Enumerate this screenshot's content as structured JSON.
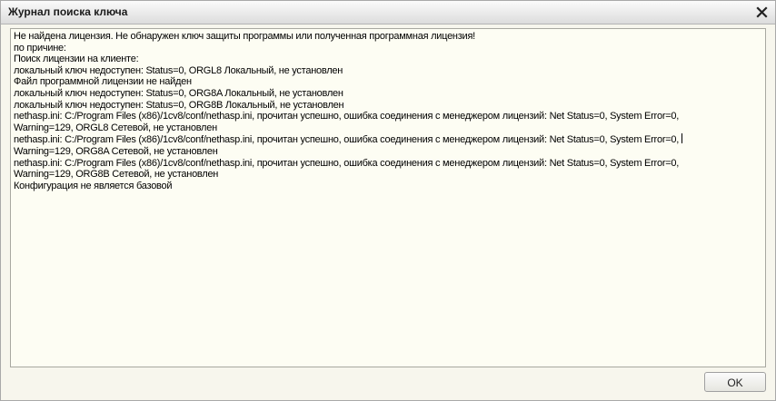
{
  "window": {
    "title": "Журнал поиска ключа"
  },
  "log": {
    "lines": [
      "Не найдена лицензия. Не обнаружен ключ защиты программы или полученная программная лицензия!",
      "по причине:",
      "Поиск лицензии на клиенте:",
      "локальный ключ недоступен: Status=0, ORGL8 Локальный, не установлен",
      "Файл программной лицензии не найден",
      "локальный ключ недоступен: Status=0, ORG8A Локальный, не установлен",
      "локальный ключ недоступен: Status=0, ORG8B Локальный, не установлен",
      "nethasp.ini: C:/Program Files (x86)/1cv8/conf/nethasp.ini, прочитан успешно, ошибка соединения с менеджером лицензий: Net Status=0, System Error=0,",
      "Warning=129, ORGL8 Сетевой, не установлен",
      "nethasp.ini: C:/Program Files (x86)/1cv8/conf/nethasp.ini, прочитан успешно, ошибка соединения с менеджером лицензий: Net Status=0, System Error=0,",
      "Warning=129, ORG8A Сетевой, не установлен",
      "nethasp.ini: C:/Program Files (x86)/1cv8/conf/nethasp.ini, прочитан успешно, ошибка соединения с менеджером лицензий: Net Status=0, System Error=0,",
      "Warning=129, ORG8B Сетевой, не установлен",
      "Конфигурация не является базовой"
    ]
  },
  "buttons": {
    "ok_label": "OK"
  },
  "icons": {
    "close": "close-icon"
  }
}
